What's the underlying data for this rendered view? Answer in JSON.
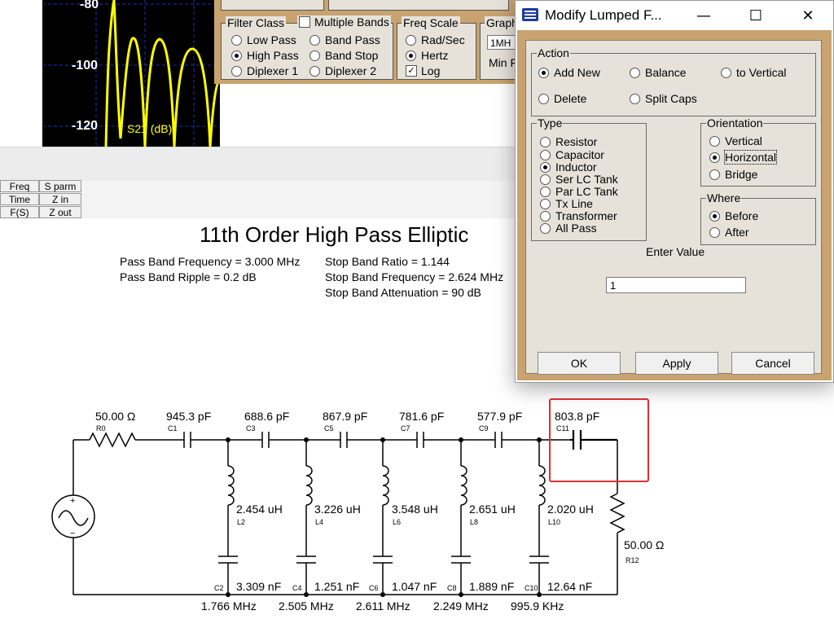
{
  "plot": {
    "y_ticks": [
      "-80",
      "-100",
      "-120"
    ],
    "legend": "S21 (dB)",
    "colors": {
      "background": "#000000",
      "trace": "#ffff00",
      "grid": "#2030c0"
    }
  },
  "filter_panel": {
    "filter_class": {
      "label": "Filter Class",
      "options": [
        "Low Pass",
        "High Pass",
        "Diplexer 1"
      ],
      "selected": "High Pass"
    },
    "multiple_bands": {
      "label": "Multiple Bands",
      "checked": false,
      "options": [
        "Band Pass",
        "Band Stop",
        "Diplexer 2"
      ]
    },
    "freq_scale": {
      "label": "Freq Scale",
      "options": [
        "Rad/Sec",
        "Hertz"
      ],
      "selected": "Hertz",
      "log_label": "Log",
      "log_checked": true
    },
    "graph": {
      "label": "Graph",
      "field_value": "1MH",
      "min_label": "Min F"
    }
  },
  "mini_buttons": [
    "Freq",
    "S parm",
    "Time",
    "Z in",
    "F(S)",
    "Z out"
  ],
  "filter_info": {
    "title": "11th Order High Pass Elliptic",
    "pass_band_frequency": "Pass Band Frequency = 3.000 MHz",
    "pass_band_ripple": "Pass Band Ripple = 0.2 dB",
    "stop_band_ratio": "Stop Band Ratio = 1.144",
    "stop_band_frequency": "Stop Band Frequency = 2.624 MHz",
    "stop_band_attenuation": "Stop Band Attenuation = 90 dB"
  },
  "schematic": {
    "source_resistor": {
      "value": "50.00 Ω",
      "ref": "R0"
    },
    "load_resistor": {
      "value": "50.00 Ω",
      "ref": "R12"
    },
    "series_caps": [
      {
        "value": "945.3 pF",
        "ref": "C1"
      },
      {
        "value": "688.6 pF",
        "ref": "C3"
      },
      {
        "value": "867.9 pF",
        "ref": "C5"
      },
      {
        "value": "781.6 pF",
        "ref": "C7"
      },
      {
        "value": "577.9 pF",
        "ref": "C9"
      },
      {
        "value": "803.8 pF",
        "ref": "C11"
      }
    ],
    "shunt_inductors": [
      {
        "value": "2.454 uH",
        "ref": "L2"
      },
      {
        "value": "3.226 uH",
        "ref": "L4"
      },
      {
        "value": "3.548 uH",
        "ref": "L6"
      },
      {
        "value": "2.651 uH",
        "ref": "L8"
      },
      {
        "value": "2.020 uH",
        "ref": "L10"
      }
    ],
    "shunt_caps": [
      {
        "value": "3.309 nF",
        "ref": "C2"
      },
      {
        "value": "1.251 nF",
        "ref": "C4"
      },
      {
        "value": "1.047 nF",
        "ref": "C6"
      },
      {
        "value": "1.889 nF",
        "ref": "C8"
      },
      {
        "value": "12.64 nF",
        "ref": "C10"
      }
    ],
    "resonances": [
      "1.766 MHz",
      "2.505 MHz",
      "2.611 MHz",
      "2.249 MHz",
      "995.9 KHz"
    ],
    "highlight_color": "#e03030"
  },
  "dialog": {
    "title": "Modify Lumped F...",
    "controls": {
      "minimize": "—",
      "maximize": "☐",
      "close": "✕"
    },
    "action": {
      "label": "Action",
      "options": [
        "Add New",
        "Balance",
        "to Vertical",
        "Delete",
        "Split Caps"
      ],
      "selected": "Add New"
    },
    "type": {
      "label": "Type",
      "options": [
        "Resistor",
        "Capacitor",
        "Inductor",
        "Ser LC Tank",
        "Par LC Tank",
        "Tx Line",
        "Transformer",
        "All Pass"
      ],
      "selected": "Inductor"
    },
    "orientation": {
      "label": "Orientation",
      "options": [
        "Vertical",
        "Horizontal",
        "Bridge"
      ],
      "selected": "Horizontal"
    },
    "where": {
      "label": "Where",
      "options": [
        "Before",
        "After"
      ],
      "selected": "Before"
    },
    "enter_value": {
      "label": "Enter Value",
      "value": "1"
    },
    "buttons": {
      "ok": "OK",
      "apply": "Apply",
      "cancel": "Cancel"
    },
    "colors": {
      "frame": "#c8a370",
      "panel": "#e6e2da"
    }
  }
}
